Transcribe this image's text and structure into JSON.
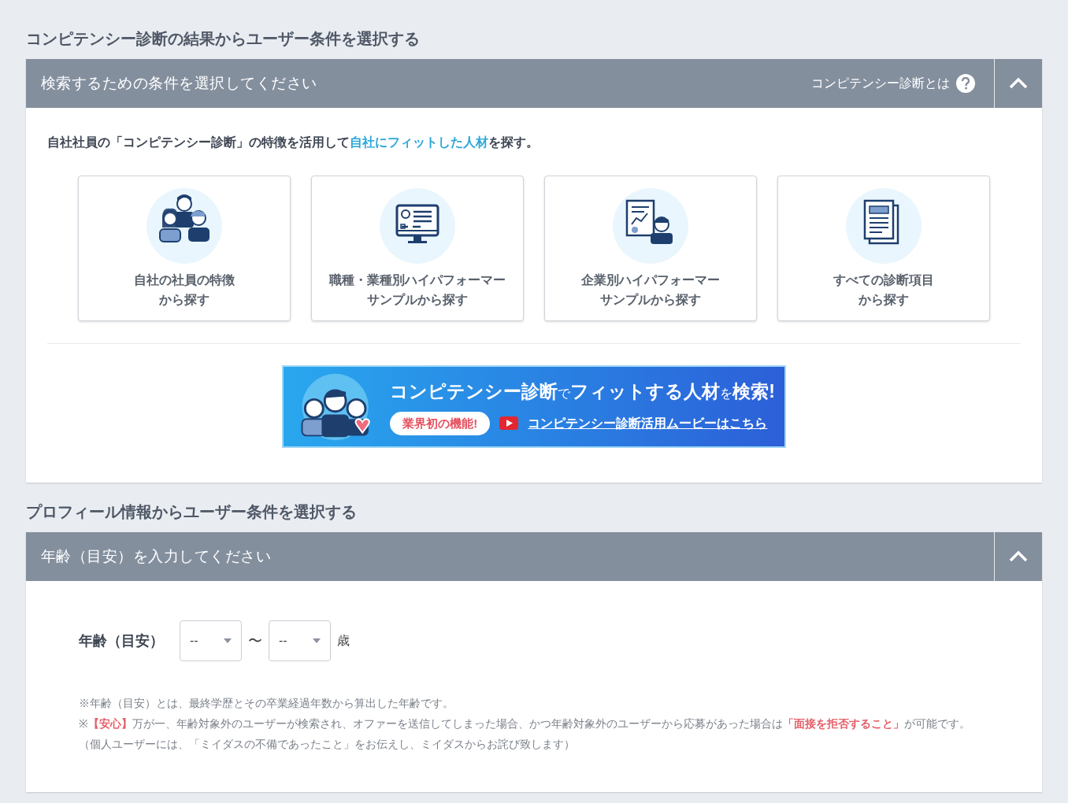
{
  "sections": [
    {
      "heading": "コンピテンシー診断の結果からユーザー条件を選択する",
      "panel_title": "検索するための条件を選択してください",
      "help_link": "コンピテンシー診断とは",
      "expanded": true,
      "kind": "competency",
      "intro": [
        {
          "text": "自社社員の「コンピテンシー診断」の特徴を活用して",
          "highlight": false
        },
        {
          "text": "自社にフィットした人材",
          "highlight": true
        },
        {
          "text": "を探す。",
          "highlight": false
        }
      ],
      "cards": [
        {
          "kind": "people",
          "lines": [
            "自社の社員の特徴",
            "から探す"
          ]
        },
        {
          "kind": "monitor",
          "lines": [
            "職種・業種別ハイパフォーマー",
            "サンプルから探す"
          ]
        },
        {
          "kind": "report",
          "lines": [
            "企業別ハイパフォーマー",
            "サンプルから探す"
          ]
        },
        {
          "kind": "document",
          "lines": [
            "すべての診断項目",
            "から探す"
          ]
        }
      ],
      "banner": {
        "headline": [
          {
            "text": "コンピテンシー診断",
            "small": false
          },
          {
            "text": "で",
            "small": true
          },
          {
            "text": "フィットする人材",
            "small": false
          },
          {
            "text": "を",
            "small": true
          },
          {
            "text": "検索!",
            "small": false
          }
        ],
        "badge": "業界初の機能!",
        "link": "コンピテンシー診断活用ムービーはこちら"
      }
    },
    {
      "heading": "プロフィール情報からユーザー条件を選択する",
      "panel_title": "年齢（目安）を入力してください",
      "expanded": true,
      "kind": "age",
      "age": {
        "label": "年齢（目安）",
        "from": "--",
        "separator": "〜",
        "to": "--",
        "unit": "歳"
      },
      "notes": [
        [
          {
            "text": "※年齢（目安）とは、最終学歴とその卒業経過年数から算出した年齢です。",
            "emphasis": false
          }
        ],
        [
          {
            "text": "※",
            "emphasis": false
          },
          {
            "text": "【安心】",
            "emphasis": true
          },
          {
            "text": "万が一、年齢対象外のユーザーが検索され、オファーを送信してしまった場合、かつ年齢対象外のユーザーから応募があった場合は",
            "emphasis": false
          },
          {
            "text": "「面接を拒否すること」",
            "emphasis": true
          },
          {
            "text": "が可能です。（個人ユーザーには、「ミイダスの不備であったこと」をお伝えし、ミイダスからお詫び致します）",
            "emphasis": false
          }
        ]
      ]
    }
  ]
}
